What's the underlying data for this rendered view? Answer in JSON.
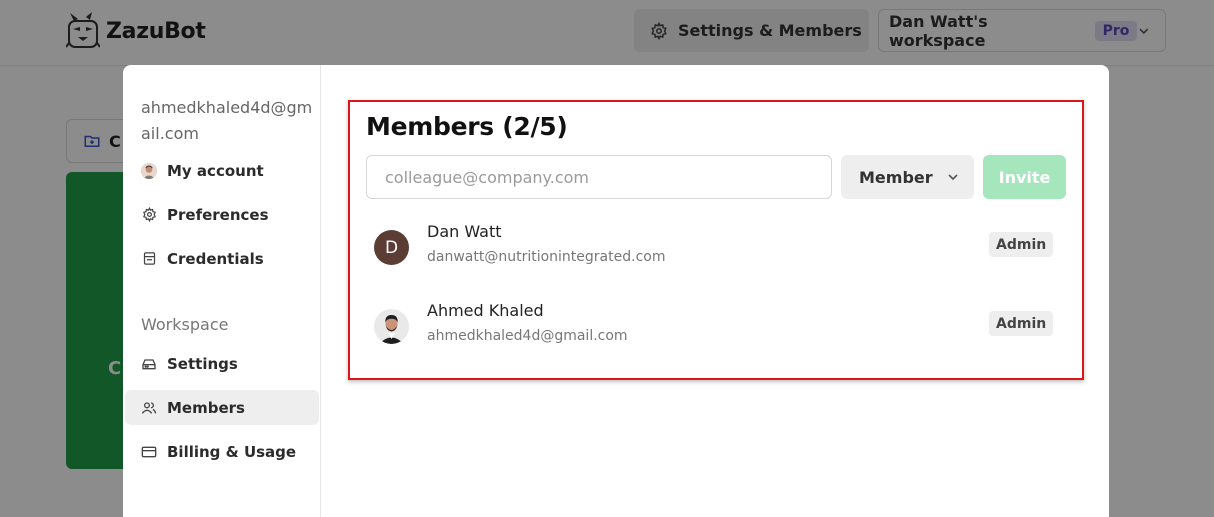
{
  "header": {
    "brand_name": "ZazuBot",
    "settings_label": "Settings & Members",
    "workspace_name": "Dan Watt's workspace",
    "plan_badge": "Pro"
  },
  "background": {
    "card_label": "C",
    "green_card_text": "C",
    "green_color": "#1f9e4a"
  },
  "sidebar": {
    "email": "ahmedkhaled4d@gmail.com",
    "account_items": [
      {
        "label": "My account",
        "icon": "avatar"
      },
      {
        "label": "Preferences",
        "icon": "gear-icon"
      },
      {
        "label": "Credentials",
        "icon": "credentials-icon"
      }
    ],
    "workspace_section": "Workspace",
    "workspace_items": [
      {
        "label": "Settings",
        "icon": "drive-icon"
      },
      {
        "label": "Members",
        "icon": "users-icon",
        "active": true
      },
      {
        "label": "Billing & Usage",
        "icon": "credit-card-icon"
      }
    ]
  },
  "members": {
    "title": "Members (2/5)",
    "invite_placeholder": "colleague@company.com",
    "invite_value": "",
    "role_selected": "Member",
    "invite_button": "Invite",
    "accent_color": "#a6e6bd",
    "list": [
      {
        "initial": "D",
        "name": "Dan Watt",
        "email": "danwatt@nutritionintegrated.com",
        "role": "Admin",
        "avatar_color": "#5c3d36"
      },
      {
        "initial": "",
        "name": "Ahmed Khaled",
        "email": "ahmedkhaled4d@gmail.com",
        "role": "Admin",
        "avatar_color": "#2b2b2b"
      }
    ]
  }
}
